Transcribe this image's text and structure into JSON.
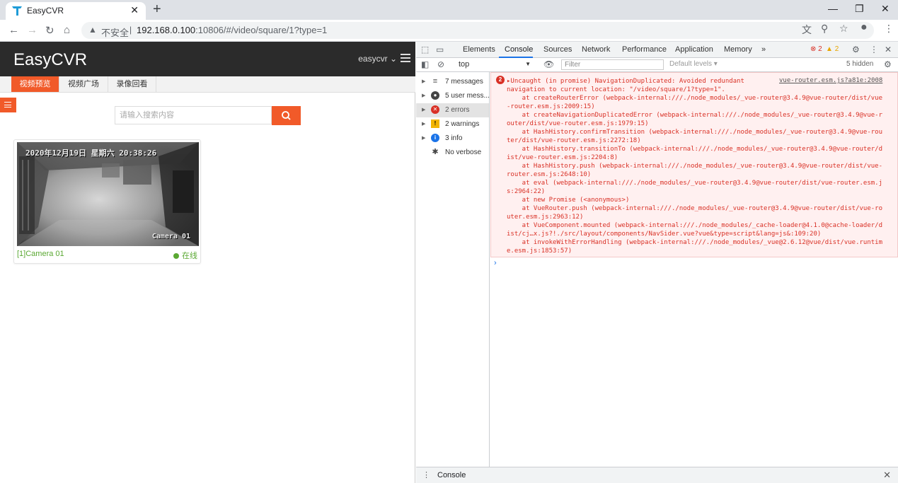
{
  "browser": {
    "tab_title": "EasyCVR",
    "tab_close": "✕",
    "new_tab": "+",
    "url_security": "不安全",
    "url_host": "192.168.0.100",
    "url_rest": ":10806/#/video/square/1?type=1"
  },
  "app": {
    "title": "EasyCVR",
    "user": "easycvr",
    "nav": [
      "视频预览",
      "视频广场",
      "录像回看"
    ],
    "search_placeholder": "请输入搜索内容",
    "camera": {
      "timestamp": "2020年12月19日 星期六 20:38:26",
      "overlay_label": "Camera 01",
      "name": "[1]Camera 01",
      "status": "在线"
    }
  },
  "devtools": {
    "tabs": [
      "Elements",
      "Console",
      "Sources",
      "Network",
      "Performance",
      "Application",
      "Memory",
      "»"
    ],
    "error_count": "2",
    "warning_count": "2",
    "context": "top",
    "filter_placeholder": "Filter",
    "levels": "Default levels ▾",
    "hidden": "5 hidden",
    "sidebar": [
      {
        "label": "7 messages",
        "icon": "list-icon"
      },
      {
        "label": "5 user mess...",
        "icon": "user-icon"
      },
      {
        "label": "2 errors",
        "icon": "error-icon"
      },
      {
        "label": "2 warnings",
        "icon": "warning-icon"
      },
      {
        "label": "3 info",
        "icon": "info-icon"
      },
      {
        "label": "No verbose",
        "icon": "bug-icon"
      }
    ],
    "error": {
      "count": "2",
      "source": "vue-router.esm.js?a81e:2008",
      "lines": [
        "▸Uncaught (in promise) NavigationDuplicated: Avoided redundant",
        "navigation to current location: \"/video/square/1?type=1\".",
        "    at createRouterError (webpack-internal:///./node_modules/_vue-router@3.4.9@vue-router/dist/vue",
        "-router.esm.js:2009:15)",
        "    at createNavigationDuplicatedError (webpack-internal:///./node_modules/_vue-router@3.4.9@vue-r",
        "outer/dist/vue-router.esm.js:1979:15)",
        "    at HashHistory.confirmTransition (webpack-internal:///./node_modules/_vue-router@3.4.9@vue-rou",
        "ter/dist/vue-router.esm.js:2272:18)",
        "    at HashHistory.transitionTo (webpack-internal:///./node_modules/_vue-router@3.4.9@vue-router/d",
        "ist/vue-router.esm.js:2204:8)",
        "    at HashHistory.push (webpack-internal:///./node_modules/_vue-router@3.4.9@vue-router/dist/vue-",
        "router.esm.js:2648:10)",
        "    at eval (webpack-internal:///./node_modules/_vue-router@3.4.9@vue-router/dist/vue-router.esm.j",
        "s:2964:22)",
        "    at new Promise (<anonymous>)",
        "    at VueRouter.push (webpack-internal:///./node_modules/_vue-router@3.4.9@vue-router/dist/vue-ro",
        "uter.esm.js:2963:12)",
        "    at VueComponent.mounted (webpack-internal:///./node_modules/_cache-loader@4.1.0@cache-loader/d",
        "ist/cj…x.js?!./src/layout/components/NavSider.vue?vue&type=script&lang=js&:109:20)",
        "    at invokeWithErrorHandling (webpack-internal:///./node_modules/_vue@2.6.12@vue/dist/vue.runtim",
        "e.esm.js:1853:57)"
      ]
    },
    "prompt": "›",
    "drawer_tab": "Console",
    "drawer_close": "✕"
  },
  "colors": {
    "accent": "#f15a29",
    "online": "#5aa832",
    "error": "#d93025"
  }
}
